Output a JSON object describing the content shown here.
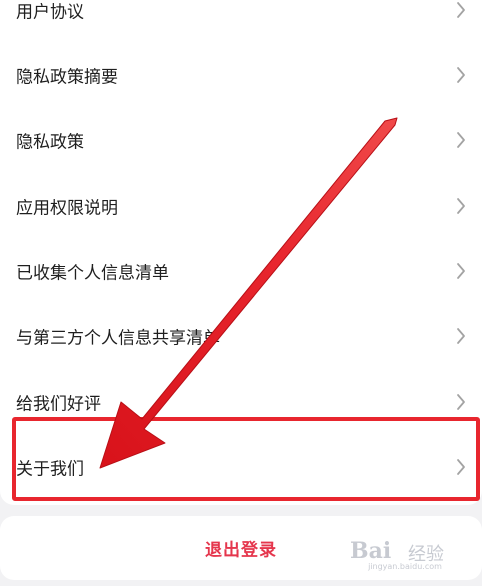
{
  "settings_list": {
    "items": [
      {
        "label": "用户协议"
      },
      {
        "label": "隐私政策摘要"
      },
      {
        "label": "隐私政策"
      },
      {
        "label": "应用权限说明"
      },
      {
        "label": "已收集个人信息清单"
      },
      {
        "label": "与第三方个人信息共享清单"
      },
      {
        "label": "给我们好评"
      },
      {
        "label": "关于我们"
      }
    ],
    "chevron_icon": "chevron-right-icon"
  },
  "logout": {
    "label": "退出登录"
  },
  "annotation": {
    "color": "#e8262e",
    "highlighted_item": "关于我们"
  },
  "colors": {
    "logout_text": "#e5364d",
    "background": "#f2f2f4"
  },
  "watermark": {
    "logo": "Bai",
    "text": "经验",
    "url": "jingyan.baidu.com"
  }
}
